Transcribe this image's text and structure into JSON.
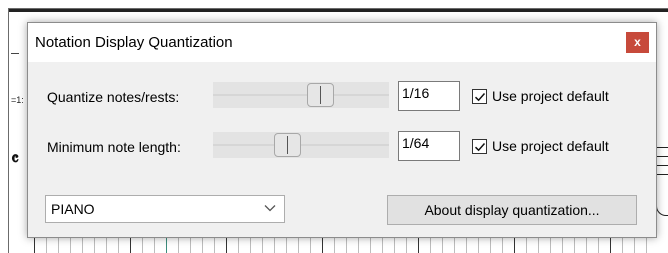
{
  "dialog": {
    "title": "Notation Display Quantization",
    "close_label": "x"
  },
  "rows": [
    {
      "label": "Quantize notes/rests:",
      "value": "1/16",
      "slider_position": 0.63,
      "checkbox_label": "Use project default",
      "checked": true
    },
    {
      "label": "Minimum note length:",
      "value": "1/64",
      "slider_position": 0.41,
      "checkbox_label": "Use project default",
      "checked": true
    }
  ],
  "dropdown": {
    "value": "PIANO"
  },
  "about_button": {
    "label": "About display quantization..."
  },
  "background": {
    "side_text": "=1:"
  },
  "colors": {
    "close_button": "#c74a3b",
    "dialog_bg": "#f0f0f0",
    "titlebar_bg": "#ffffff"
  }
}
